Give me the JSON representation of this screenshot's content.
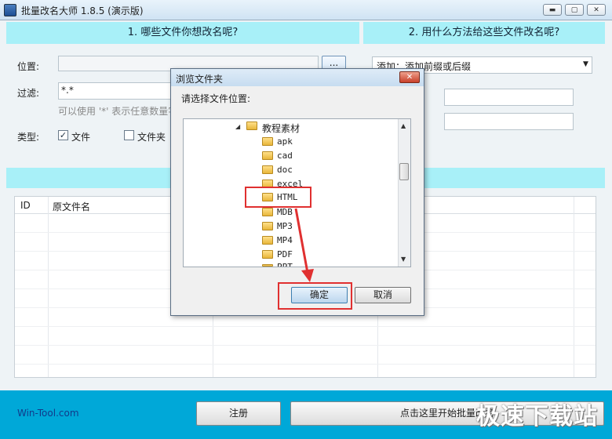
{
  "window": {
    "title": "批量改名大师 1.8.5 (演示版)",
    "min": "▬",
    "max": "▢",
    "close": "✕"
  },
  "left_panel": {
    "header": "1. 哪些文件你想改名呢?",
    "location_label": "位置:",
    "location_value": "",
    "browse_label": "...",
    "filter_label": "过滤:",
    "filter_value": "*.*",
    "hint": "可以使用 '*' 表示任意数量字",
    "type_label": "类型:",
    "type_file_label": "文件",
    "type_file_checked": true,
    "type_folder_label": "文件夹",
    "type_folder_checked": false
  },
  "right_panel": {
    "header": "2. 用什么方法给这些文件改名呢?",
    "method_value": "添加：添加前缀或后缀",
    "field1": "",
    "field2": ""
  },
  "table": {
    "columns": [
      "ID",
      "原文件名"
    ],
    "rows": []
  },
  "footer": {
    "brand": "Win-Tool.com",
    "register_label": "注册",
    "start_label": "点击这里开始批量改名"
  },
  "watermark": "极速下载站",
  "dialog": {
    "title": "浏览文件夹",
    "close": "✕",
    "prompt": "请选择文件位置:",
    "tree_root": "教程素材",
    "tree_items": [
      "apk",
      "cad",
      "doc",
      "excel",
      "HTML",
      "MDB",
      "MP3",
      "MP4",
      "PDF",
      "PPT"
    ],
    "selected_item": "HTML",
    "ok_label": "确定",
    "cancel_label": "取消"
  },
  "colors": {
    "accent_blue": "#00a8d8",
    "panel_cyan": "#a8f0f8",
    "highlight_red": "#e03030"
  }
}
